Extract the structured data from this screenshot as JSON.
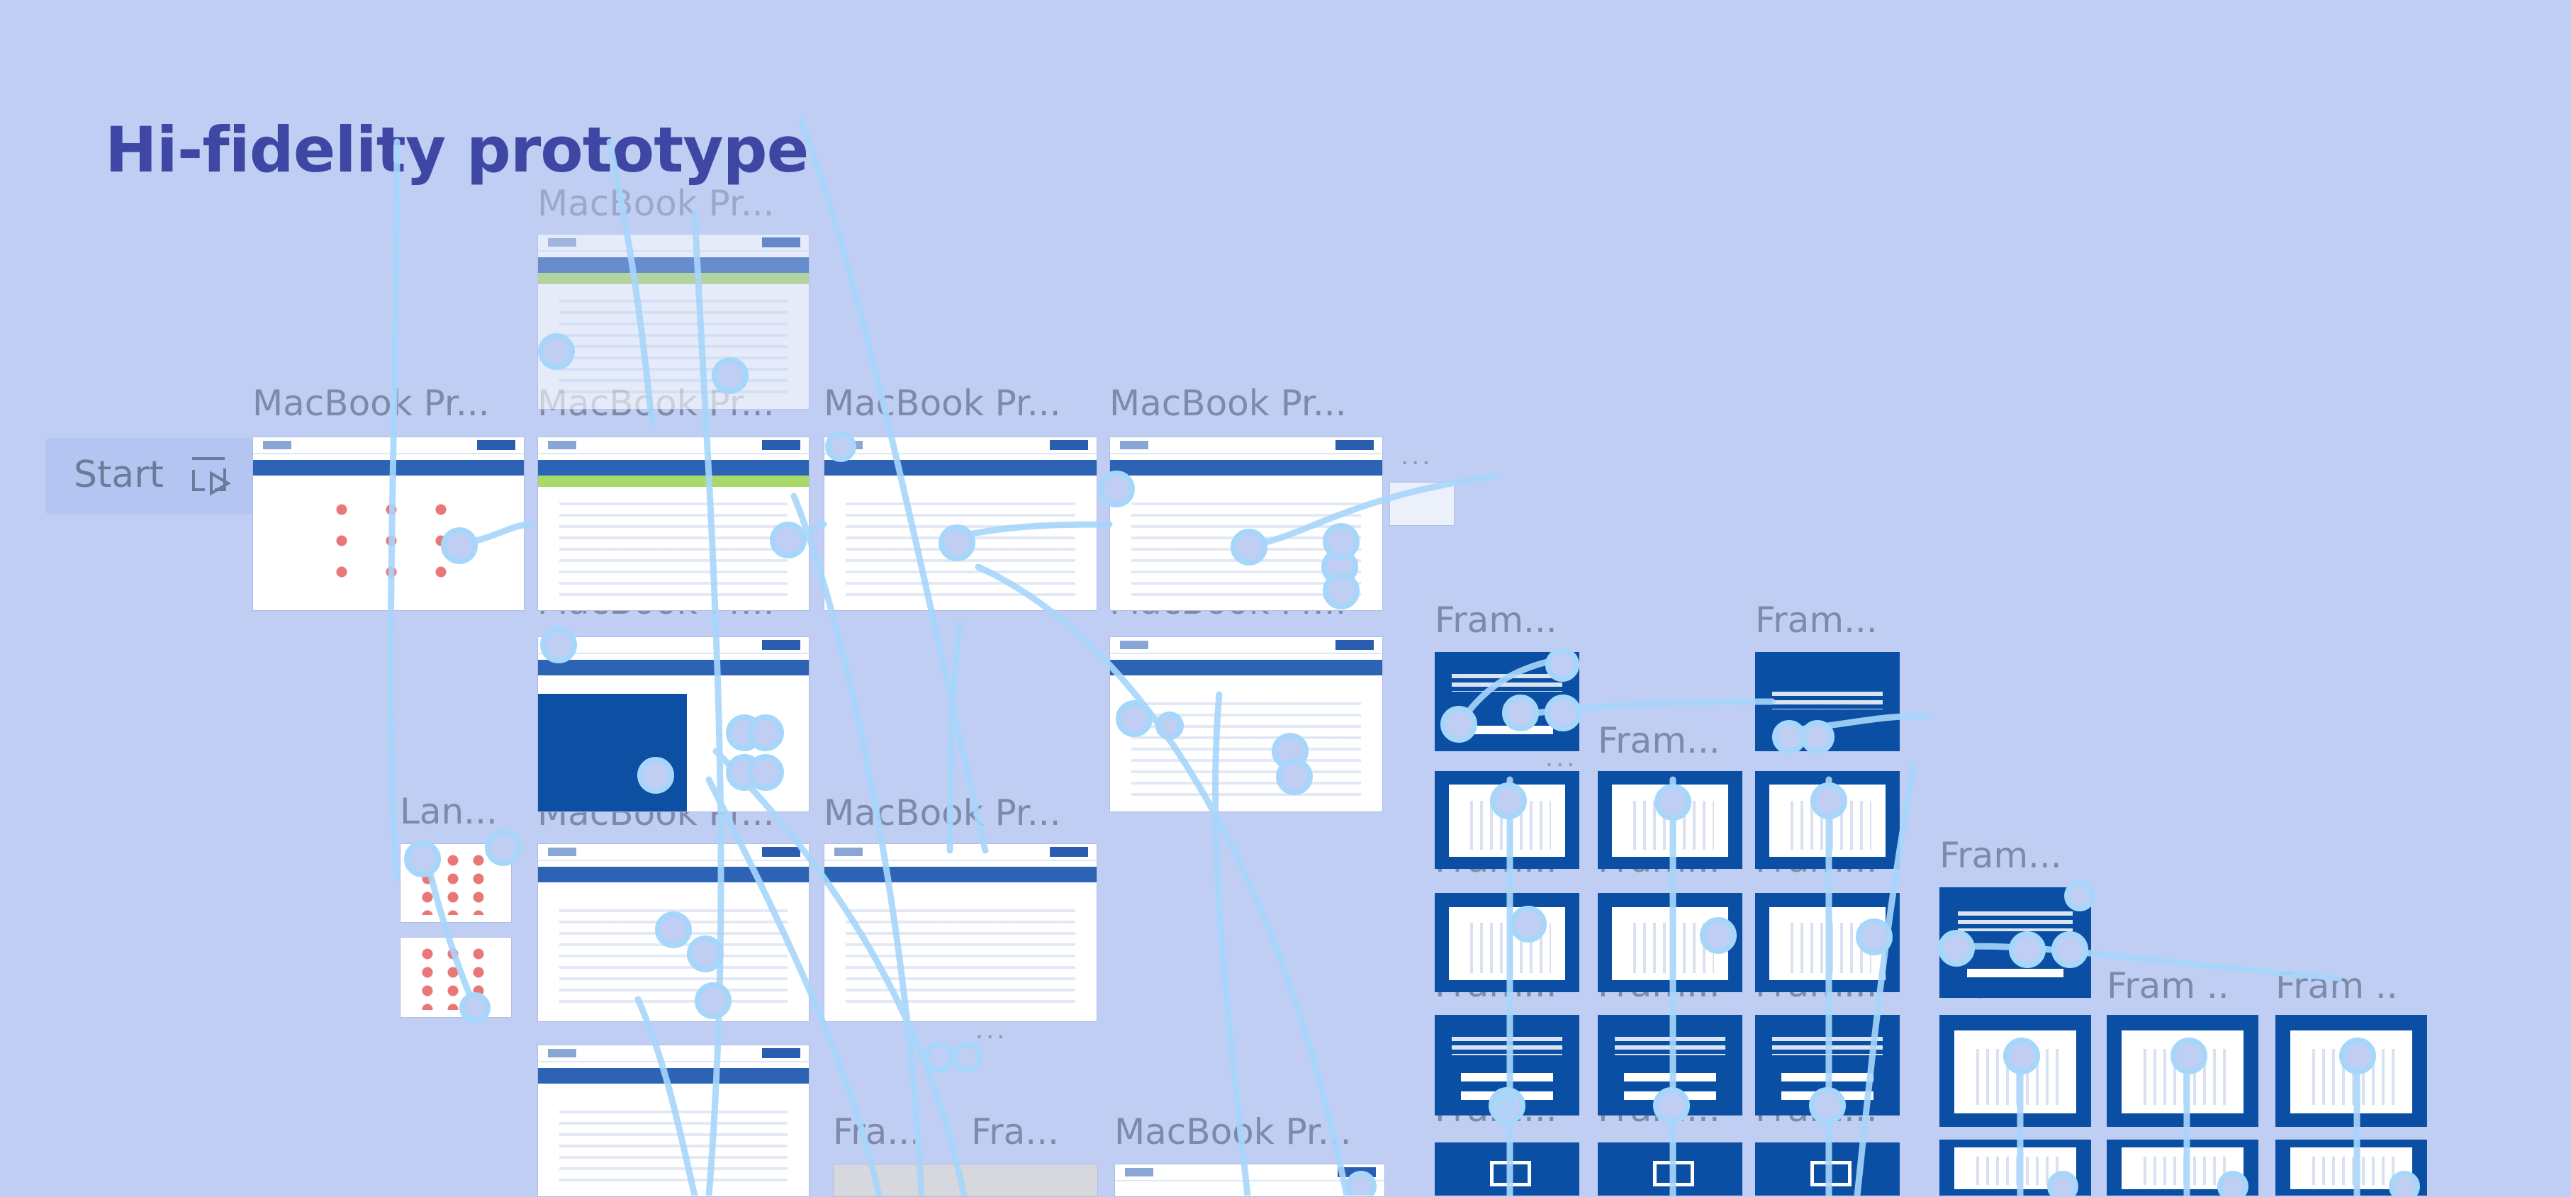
{
  "page": {
    "title": "Hi-fidelity prototype"
  },
  "start": {
    "label": "Start",
    "icon": "play-flow-icon"
  },
  "frame_labels": {
    "macbook": "MacBook Pr...",
    "fram": "Fram...",
    "fram_short": "Fram ..",
    "fra": "Fra...",
    "lan": "Lan..."
  },
  "overflow_label": "...",
  "colors": {
    "canvas": "#c1cef4",
    "title": "#3f47a4",
    "wire": "#a7d6fb",
    "frame_blue": "#0a4fa4"
  }
}
